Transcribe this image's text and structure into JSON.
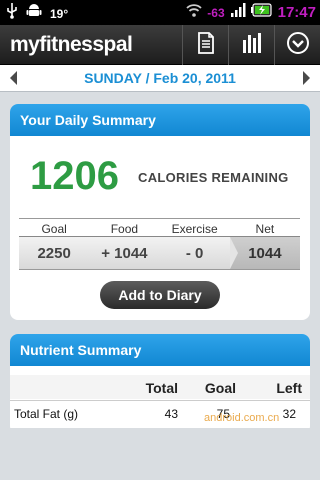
{
  "status_bar": {
    "temperature": "19°",
    "signal_strength": "-63",
    "time": "17:47",
    "accent_color": "#c01fc0"
  },
  "header": {
    "logo": "myfitnesspal",
    "icons": [
      "usb-icon",
      "android-icon",
      "document-icon",
      "bar-chart-icon",
      "dropdown-icon"
    ]
  },
  "date_nav": {
    "date": "SUNDAY / Feb 20, 2011"
  },
  "daily_summary": {
    "title": "Your Daily Summary",
    "calories_remaining": "1206",
    "calories_label": "CALORIES REMAINING",
    "columns": [
      "Goal",
      "Food",
      "Exercise",
      "Net"
    ],
    "values": [
      "2250",
      "+ 1044",
      "- 0",
      "1044"
    ],
    "add_button": "Add to Diary"
  },
  "nutrient_summary": {
    "title": "Nutrient Summary",
    "columns": [
      "Total",
      "Goal",
      "Left"
    ],
    "rows": [
      {
        "name": "Total Fat (g)",
        "total": "43",
        "goal": "75",
        "left": "32"
      }
    ]
  },
  "watermark": "android.com.cn"
}
